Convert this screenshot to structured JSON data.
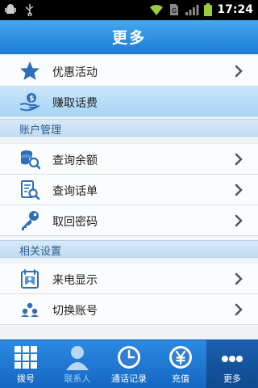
{
  "status_bar": {
    "time": "17:24"
  },
  "title_bar": {
    "title": "更多"
  },
  "menu": {
    "top_items": [
      {
        "label": "优惠活动",
        "icon": "star-icon"
      },
      {
        "label": "赚取话费",
        "icon": "hand-coin-icon"
      }
    ],
    "account_section": {
      "title": "账户管理",
      "items": [
        {
          "label": "查询余额",
          "icon": "coins-search-icon"
        },
        {
          "label": "查询话单",
          "icon": "bill-search-icon"
        },
        {
          "label": "取回密码",
          "icon": "key-icon"
        }
      ]
    },
    "settings_section": {
      "title": "相关设置",
      "items": [
        {
          "label": "来电显示",
          "icon": "caller-id-icon"
        },
        {
          "label": "切换账号",
          "icon": "switch-account-icon"
        }
      ]
    }
  },
  "tab_bar": {
    "tabs": [
      {
        "label": "拨号",
        "icon": "dialpad-icon"
      },
      {
        "label": "联系人",
        "icon": "contact-icon"
      },
      {
        "label": "通话记录",
        "icon": "clock-icon"
      },
      {
        "label": "充值",
        "icon": "yuan-icon"
      },
      {
        "label": "更多",
        "icon": "more-icon"
      }
    ],
    "active": "更多"
  },
  "colors": {
    "accent": "#1b7ed6",
    "icon_blue": "#2f6fb8"
  }
}
